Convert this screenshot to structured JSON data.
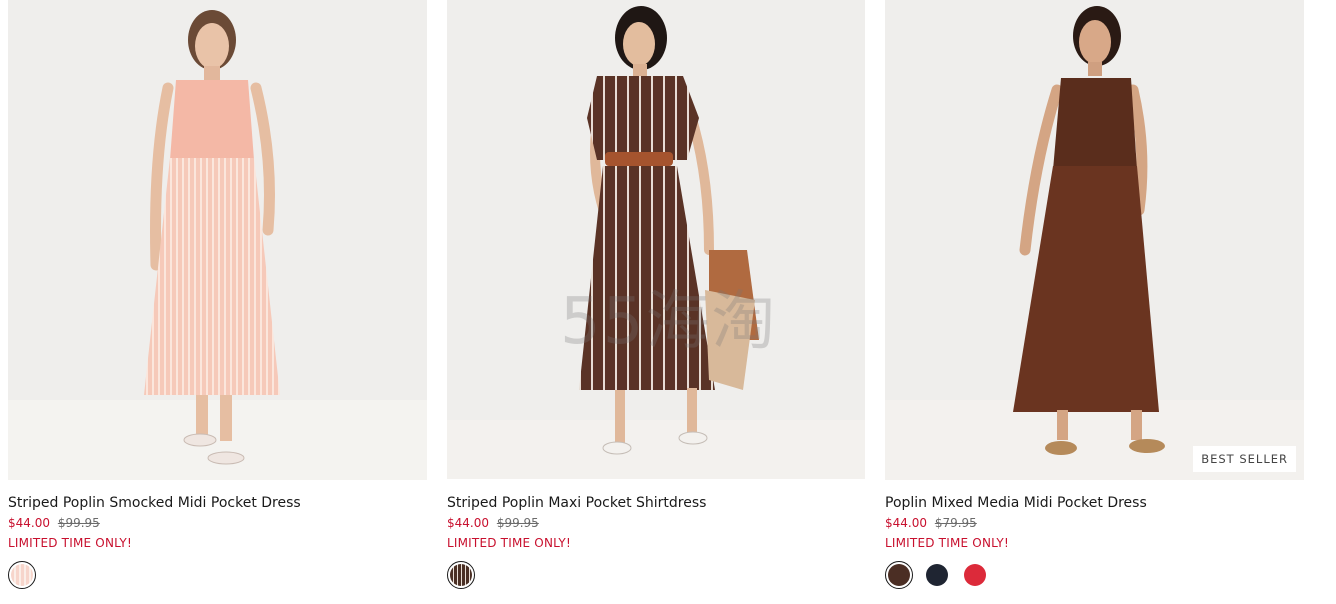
{
  "products": [
    {
      "title": "Striped Poplin Smocked Midi Pocket Dress",
      "price": "$44.00",
      "original_price": "$99.95",
      "promo": "LIMITED TIME ONLY!",
      "badge": "",
      "swatches": [
        {
          "name": "pink-stripe",
          "color": "#f7d5cb",
          "selected": true
        }
      ]
    },
    {
      "title": "Striped Poplin Maxi Pocket Shirtdress",
      "price": "$44.00",
      "original_price": "$99.95",
      "promo": "LIMITED TIME ONLY!",
      "badge": "",
      "swatches": [
        {
          "name": "brown-stripe",
          "color": "#4a2f24",
          "selected": true
        }
      ]
    },
    {
      "title": "Poplin Mixed Media Midi Pocket Dress",
      "price": "$44.00",
      "original_price": "$79.95",
      "promo": "LIMITED TIME ONLY!",
      "badge": "BEST SELLER",
      "swatches": [
        {
          "name": "brown",
          "color": "#4b2e24",
          "selected": true
        },
        {
          "name": "navy",
          "color": "#1f2532",
          "selected": false
        },
        {
          "name": "red",
          "color": "#dc2a3a",
          "selected": false
        }
      ]
    }
  ],
  "watermark": "55海淘",
  "colors": {
    "sale_red": "#c8102e",
    "strike_gray": "#6b6b6b",
    "photo_background": "#eeeeec"
  }
}
